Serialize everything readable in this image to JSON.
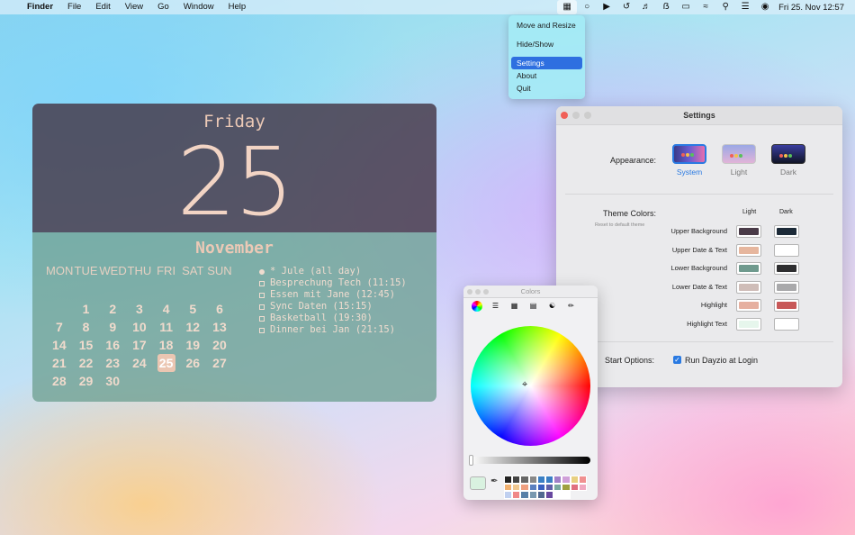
{
  "menubar": {
    "apple": "",
    "app": "Finder",
    "items": [
      "File",
      "Edit",
      "View",
      "Go",
      "Window",
      "Help"
    ],
    "status_icons": [
      "calendar-icon",
      "circle-icon",
      "play-icon",
      "history-icon",
      "volume-icon",
      "bluetooth-icon",
      "battery-icon",
      "wifi-icon",
      "search-icon",
      "control-center-icon",
      "siri-icon"
    ],
    "clock": "Fri 25. Nov  12:57"
  },
  "dropdown": {
    "items": [
      "Move and Resize",
      "Hide/Show",
      "Settings",
      "About",
      "Quit"
    ],
    "selected": "Settings"
  },
  "widget": {
    "day_name": "Friday",
    "day_number": "25",
    "month": "November",
    "weekdays": [
      "MON",
      "TUE",
      "WED",
      "THU",
      "FRI",
      "SAT",
      "SUN"
    ],
    "weeks": [
      [
        "",
        "",
        "",
        "",
        "",
        "",
        ""
      ],
      [
        "",
        "1",
        "2",
        "3",
        "4",
        "5",
        "6"
      ],
      [
        "7",
        "8",
        "9",
        "10",
        "11",
        "12",
        "13"
      ],
      [
        "14",
        "15",
        "16",
        "17",
        "18",
        "19",
        "20"
      ],
      [
        "21",
        "22",
        "23",
        "24",
        "25",
        "26",
        "27"
      ],
      [
        "28",
        "29",
        "30",
        "",
        "",
        "",
        ""
      ]
    ],
    "today": "25",
    "events": [
      {
        "text": "* Jule (all day)",
        "filled": true
      },
      {
        "text": "Besprechung Tech (11:15)",
        "filled": false
      },
      {
        "text": "Essen mit Jane (12:45)",
        "filled": false
      },
      {
        "text": "Sync Daten (15:15)",
        "filled": false
      },
      {
        "text": "Basketball (19:30)",
        "filled": true
      },
      {
        "text": "Dinner bei Jan (21:15)",
        "filled": true
      }
    ]
  },
  "settings": {
    "title": "Settings",
    "appearance_label": "Appearance:",
    "appearance_options": [
      {
        "label": "System",
        "selected": true
      },
      {
        "label": "Light",
        "selected": false
      },
      {
        "label": "Dark",
        "selected": false
      }
    ],
    "theme_colors_label": "Theme Colors:",
    "reset_link": "Reset to default theme",
    "col_light": "Light",
    "col_dark": "Dark",
    "swatches": [
      {
        "label": "Upper Background",
        "light": "#4a3b48",
        "dark": "#1c2a38"
      },
      {
        "label": "Upper Date & Text",
        "light": "#e6b69e",
        "dark": "#ffffff"
      },
      {
        "label": "Lower Background",
        "light": "#6f9a8e",
        "dark": "#2e2e30"
      },
      {
        "label": "Lower Date & Text",
        "light": "#cfbdb8",
        "dark": "#a9a9ab"
      },
      {
        "label": "Highlight",
        "light": "#e6b0a0",
        "dark": "#c85858"
      },
      {
        "label": "Highlight Text",
        "light": "#e6f6ec",
        "dark": "#ffffff"
      }
    ],
    "start_options_label": "Start Options:",
    "run_at_login_label": "Run Dayzio at Login",
    "run_at_login_checked": true
  },
  "colors_panel": {
    "title": "Colors",
    "tools": [
      "color-wheel-icon",
      "color-sliders-icon",
      "color-palettes-icon",
      "image-palettes-icon",
      "pencils-icon",
      "crayon-icon"
    ],
    "current_color": "#d9f2e0",
    "swatch_grid": [
      "#222222",
      "#444444",
      "#666666",
      "#888888",
      "#3a7fc4",
      "#3a7fc4",
      "#a080c8",
      "#d0a0d8",
      "#e8d080",
      "#f09090",
      "#f0b070",
      "#f0c890",
      "#f0a080",
      "#5a80c0",
      "#3860c0",
      "#6060a8",
      "#78a8a0",
      "#a0a040",
      "#e07080",
      "#f0a8c0",
      "#c0d0f0",
      "#f08888",
      "#5880a8",
      "#7898b0",
      "#506890",
      "#6848a0",
      "#ffffff",
      "#ffffff"
    ]
  }
}
